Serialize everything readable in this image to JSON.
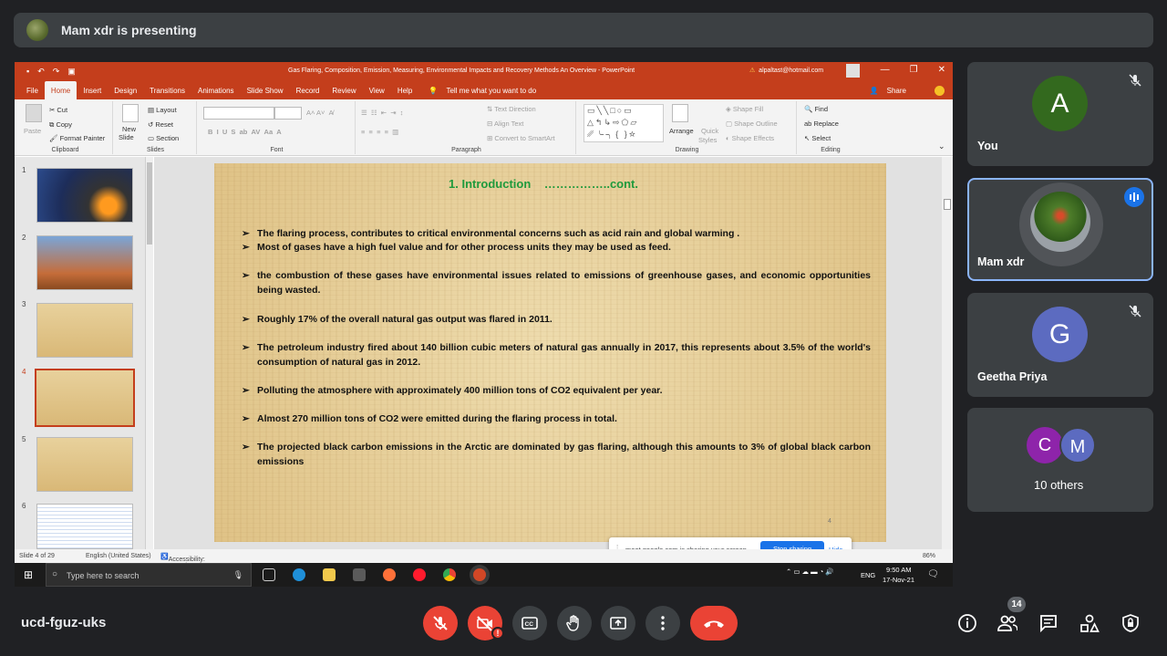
{
  "meet": {
    "presenting_text": "Mam xdr is presenting",
    "meeting_code": "ucd-fguz-uks",
    "participant_count": "14",
    "tiles": [
      {
        "initial": "A",
        "name": "You",
        "color": "#33691e"
      },
      {
        "name": "Mam xdr"
      },
      {
        "initial": "G",
        "name": "Geetha Priya",
        "color": "#5c6bc0"
      },
      {
        "initials": [
          "C",
          "M"
        ],
        "name": "10 others",
        "colors": [
          "#8e24aa",
          "#5c6bc0"
        ]
      }
    ]
  },
  "powerpoint": {
    "title": "Gas Flaring, Composition, Emission, Measuring, Environmental Impacts and Recovery Methods An Overview  -  PowerPoint",
    "account": "alpaltast@hotmail.com",
    "menu": [
      "File",
      "Home",
      "Insert",
      "Design",
      "Transitions",
      "Animations",
      "Slide Show",
      "Record",
      "Review",
      "View",
      "Help"
    ],
    "tell_me": "Tell me what you want to do",
    "share": "Share",
    "ribbon": {
      "paste": "Paste",
      "cut": "Cut",
      "copy": "Copy",
      "format_painter": "Format Painter",
      "clipboard": "Clipboard",
      "new_slide": "New",
      "new_slide2": "Slide",
      "layout": "Layout",
      "reset": "Reset",
      "section": "Section",
      "slides": "Slides",
      "font": "Font",
      "paragraph": "Paragraph",
      "text_direction": "Text Direction",
      "align_text": "Align Text",
      "convert_smartart": "Convert to SmartArt",
      "arrange": "Arrange",
      "quick_styles": "Quick",
      "quick_styles2": "Styles",
      "shape_fill": "Shape Fill",
      "shape_outline": "Shape Outline",
      "shape_effects": "Shape Effects",
      "drawing": "Drawing",
      "find": "Find",
      "replace": "Replace",
      "select": "Select",
      "editing": "Editing"
    },
    "slide_numbers": [
      "1",
      "2",
      "3",
      "4",
      "5",
      "6"
    ],
    "slide": {
      "heading": "1. Introduction    ……………..cont.",
      "bullets": [
        "The flaring process, contributes to critical environmental concerns such as acid rain and global warming .",
        "Most of gases have a high fuel value and for other process units they may be used as feed.",
        " the combustion of these gases have environmental issues related to emissions of greenhouse gases, and economic opportunities being wasted.",
        " Roughly 17% of the overall natural gas output was flared in 2011.",
        " The petroleum industry fired about 140 billion cubic meters of natural gas annually in 2017, this represents about 3.5% of the world's consumption of natural gas in 2012.",
        "Polluting the atmosphere with approximately 400 million tons of CO2 equivalent per year.",
        " Almost 270 million tons of CO2 were emitted during the flaring process in total.",
        "The projected black carbon emissions in the Arctic are dominated by gas flaring, although this amounts to 3% of global black carbon emissions"
      ],
      "page_number": "4"
    },
    "status": {
      "slide_of": "Slide 4 of 29",
      "language": "English (United States)",
      "accessibility": "Accessibility: Investigate",
      "zoom": "86%"
    },
    "sharing_bar": {
      "message": "meet.google.com is sharing your screen.",
      "stop": "Stop sharing",
      "hide": "Hide"
    }
  },
  "taskbar": {
    "search_placeholder": "Type here to search",
    "time": "9:50 AM",
    "date": "17-Nov-21",
    "lang": "ENG"
  }
}
